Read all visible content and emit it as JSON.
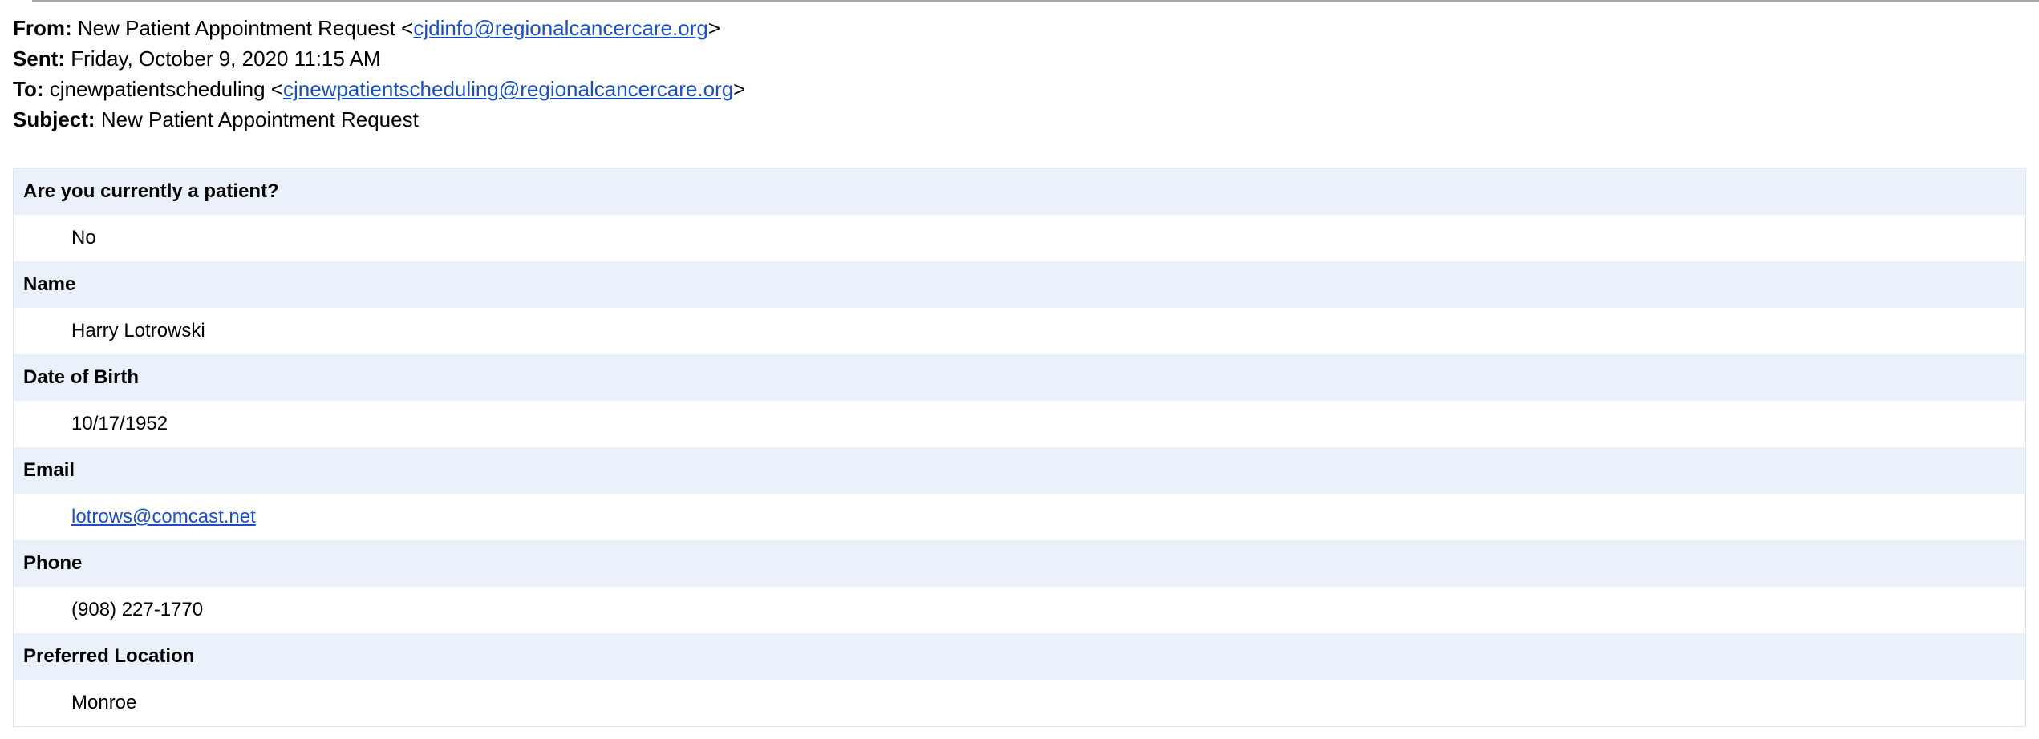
{
  "header": {
    "from_label": "From:",
    "from_name": "New Patient Appointment Request <",
    "from_email": "cjdinfo@regionalcancercare.org",
    "from_close": ">",
    "sent_label": "Sent:",
    "sent_value": "Friday, October 9, 2020 11:15 AM",
    "to_label": "To:",
    "to_name": "cjnewpatientscheduling <",
    "to_email": "cjnewpatientscheduling@regionalcancercare.org",
    "to_close": ">",
    "subject_label": "Subject:",
    "subject_value": "New Patient Appointment Request"
  },
  "form": {
    "fields": [
      {
        "label": "Are you currently a patient?",
        "value": "No"
      },
      {
        "label": "Name",
        "value": "Harry Lotrowski"
      },
      {
        "label": "Date of Birth",
        "value": "10/17/1952"
      },
      {
        "label": "Email",
        "value": "lotrows@comcast.net"
      },
      {
        "label": "Phone",
        "value": "(908) 227-1770"
      },
      {
        "label": "Preferred Location",
        "value": "Monroe"
      }
    ]
  },
  "colors": {
    "link": "#1a4fc4",
    "question_bg": "#eaf1fa"
  }
}
